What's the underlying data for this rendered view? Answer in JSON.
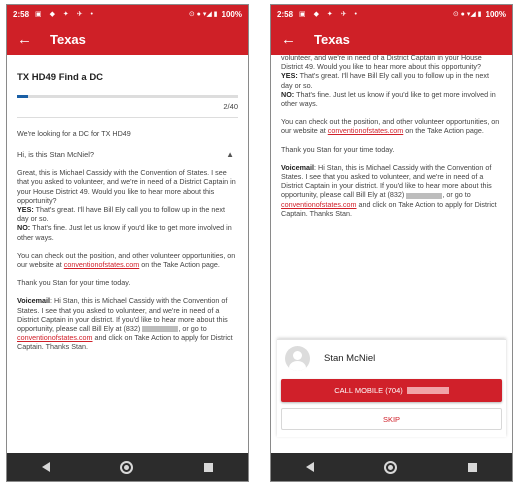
{
  "status_bar": {
    "time": "2:58",
    "battery": "100%"
  },
  "app_bar": {
    "title": "Texas"
  },
  "campaign": {
    "title": "TX HD49 Find a DC",
    "progress_text": "2/40",
    "progress_fraction": 0.05
  },
  "messages": {
    "intro": "We're looking for a DC for TX HD49",
    "question": "Hi, is this Stan McNiel?",
    "p1": "Great, this is Michael Cassidy with the Convention of States. I see that you asked to volunteer, and we're in need of a District Captain in your House District 49. Would you like to hear more about this opportunity?",
    "p1_tail": "volunteer, and we're in need of a District Captain in your House District 49. Would you like to hear more about this opportunity?",
    "yes_label": "YES:",
    "yes_text": "That's great. I'll have Bill Ely call you to follow up in the next day or so.",
    "no_label": "NO:",
    "no_text": "That's fine. Just let us know if you'd like to get more involved in other ways.",
    "p2_a": "You can check out the position, and other volunteer opportunities, on our website at",
    "p2_link": "conventionofstates.com",
    "p2_b": "on the Take Action page.",
    "thanks": "Thank you Stan for your time today.",
    "vm_label": "Voicemail",
    "vm_text_a": ": Hi Stan, this is Michael Cassidy with the Convention of States. I see that you asked to volunteer, and we're in need of a District Captain in your district. If you'd like to hear more about this opportunity, please call Bill Ely at (832)",
    "vm_text_b": ", or go to",
    "vm_link": "conventionofstates.com",
    "vm_text_c": "and click on Take Action to apply for District Captain. Thanks Stan."
  },
  "contact": {
    "name": "Stan McNiel",
    "call_label": "CALL MOBILE (704)",
    "skip_label": "SKIP"
  },
  "colors": {
    "brand_red": "#cf2027",
    "progress_blue": "#1a5fa5",
    "nav_dark": "#2c2c2c"
  },
  "icons": {
    "back": "arrow-left-icon",
    "chevron": "chevron-up-icon",
    "avatar": "person-avatar-icon",
    "nav": [
      "nav-back-icon",
      "nav-home-icon",
      "nav-recent-icon"
    ]
  }
}
